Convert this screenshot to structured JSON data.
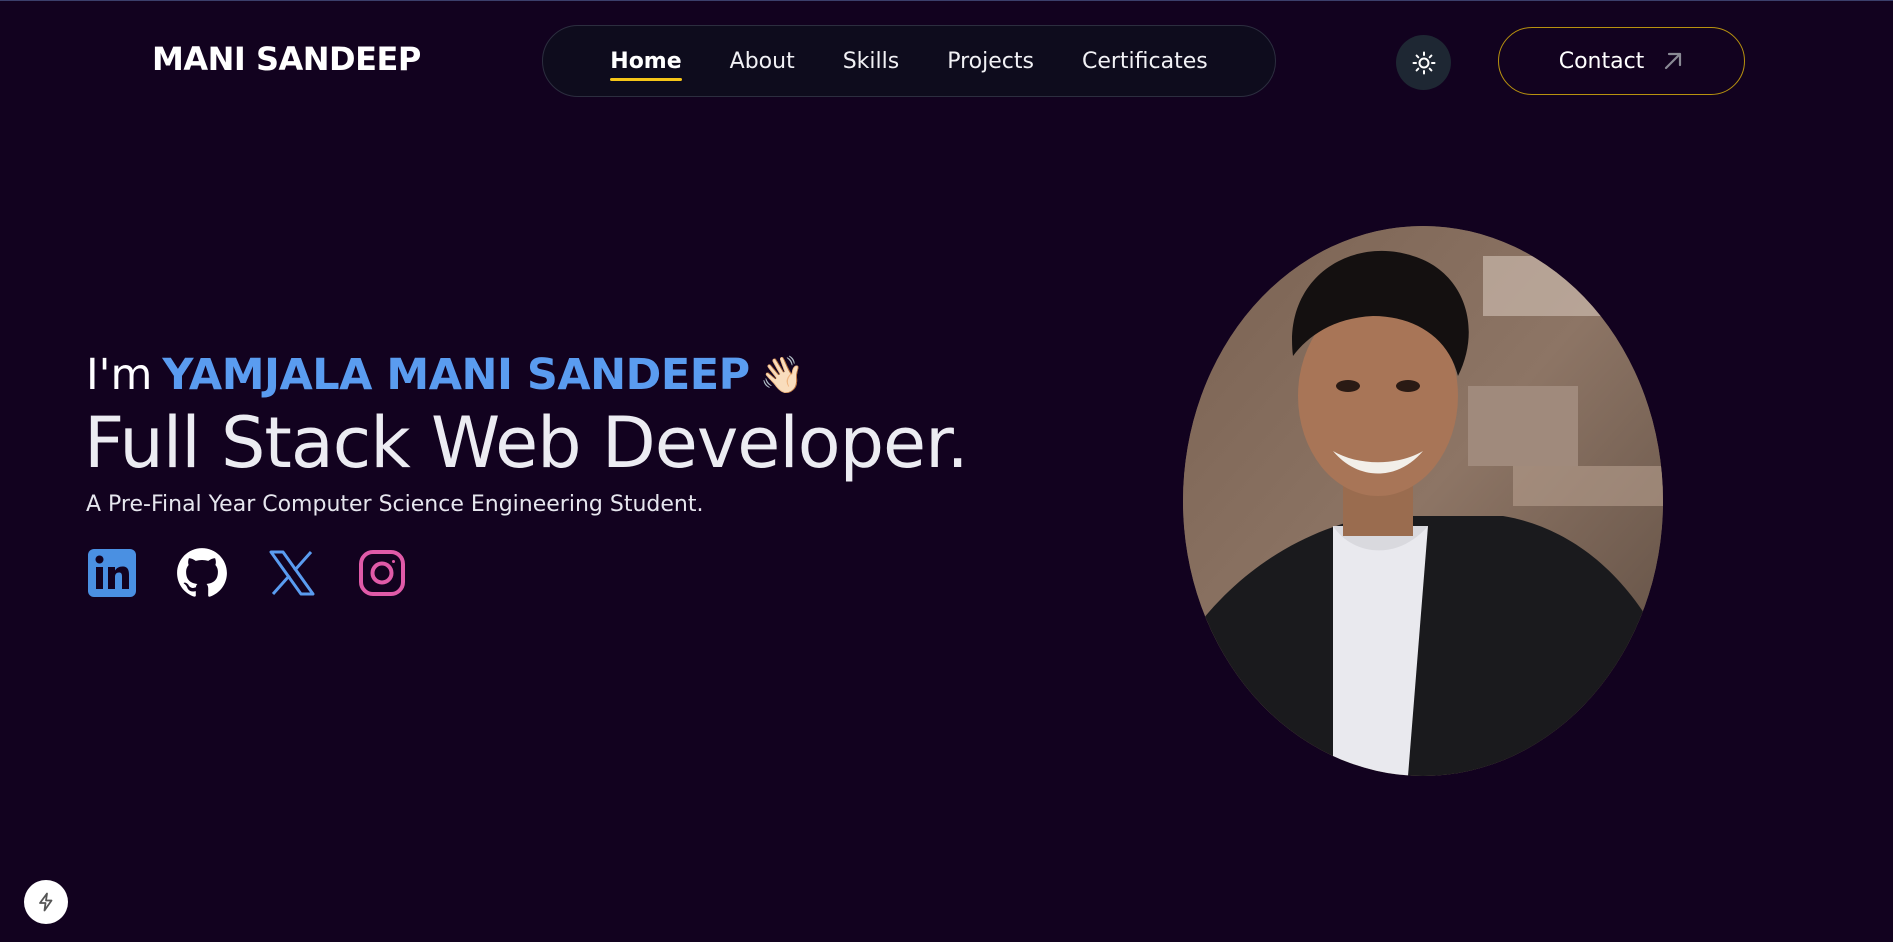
{
  "brand": "MANI SANDEEP",
  "nav": {
    "items": [
      {
        "label": "Home",
        "active": true
      },
      {
        "label": "About",
        "active": false
      },
      {
        "label": "Skills",
        "active": false
      },
      {
        "label": "Projects",
        "active": false
      },
      {
        "label": "Certificates",
        "active": false
      }
    ]
  },
  "header": {
    "theme_icon": "sun-icon",
    "contact_label": "Contact",
    "contact_icon": "arrow-up-right-icon"
  },
  "hero": {
    "greeting": "I'm",
    "name": "YAMJALA MANI SANDEEP",
    "wave": "👋🏻",
    "headline": "Full Stack Web Developer.",
    "subline": "A Pre-Final Year Computer Science Engineering Student."
  },
  "socials": [
    {
      "name": "linkedin-icon",
      "color": "#4a90e2"
    },
    {
      "name": "github-icon",
      "color": "#ffffff"
    },
    {
      "name": "x-icon",
      "color": "#5a9cf0"
    },
    {
      "name": "instagram-icon",
      "color": "#e05aa8"
    }
  ],
  "colors": {
    "background": "#12021f",
    "accent_name": "#5a9cf0",
    "active_underline": "#f5c518",
    "contact_border": "#b8920f"
  },
  "floating": {
    "icon": "bolt-icon"
  }
}
